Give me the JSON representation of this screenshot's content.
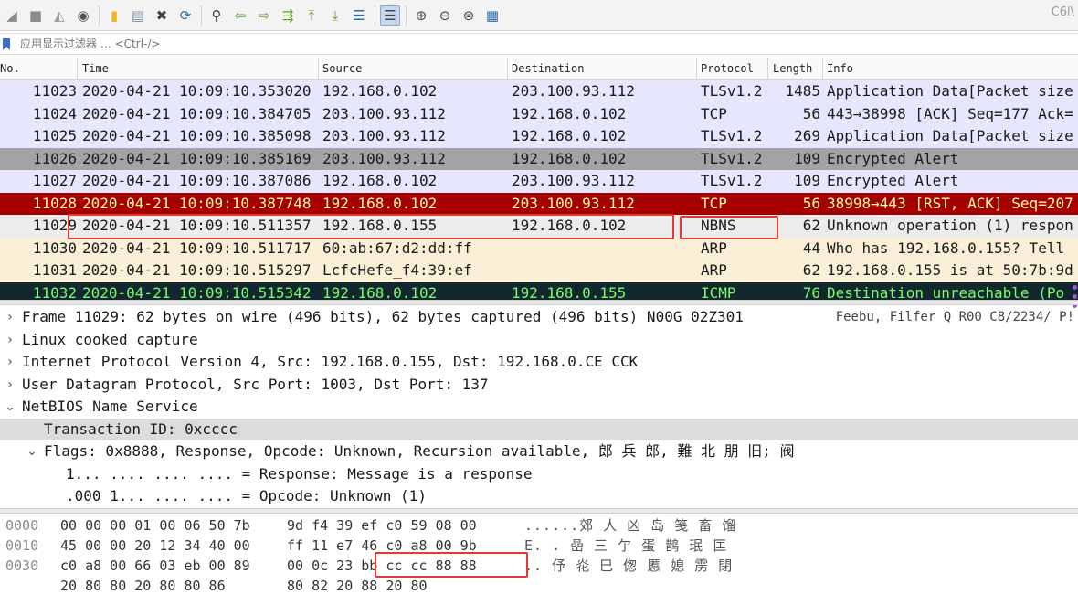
{
  "toolbar": {
    "version_badge": "C6l\\",
    "buttons": [
      {
        "name": "start-capture-icon",
        "glyph": "◢",
        "color": "#8a8a8a"
      },
      {
        "name": "stop-capture-icon",
        "glyph": "■",
        "color": "#8a8a8a"
      },
      {
        "name": "restart-capture-icon",
        "glyph": "◭",
        "color": "#9a9a9a"
      },
      {
        "name": "capture-options-icon",
        "glyph": "◉",
        "color": "#555555"
      },
      {
        "name": "open-file-icon",
        "glyph": "▮",
        "color": "#f0b429"
      },
      {
        "name": "save-file-icon",
        "glyph": "▤",
        "color": "#7a8aa0"
      },
      {
        "name": "close-file-icon",
        "glyph": "✖",
        "color": "#334455"
      },
      {
        "name": "reload-file-icon",
        "glyph": "⟳",
        "color": "#2b6cb0"
      },
      {
        "name": "find-packet-icon",
        "glyph": "⚲",
        "color": "#444444"
      },
      {
        "name": "go-back-icon",
        "glyph": "⇦",
        "color": "#5aa02c"
      },
      {
        "name": "go-forward-icon",
        "glyph": "⇨",
        "color": "#5aa02c"
      },
      {
        "name": "go-to-packet-icon",
        "glyph": "⇶",
        "color": "#5aa02c"
      },
      {
        "name": "go-first-icon",
        "glyph": "⤒",
        "color": "#5aa02c"
      },
      {
        "name": "go-last-icon",
        "glyph": "⤓",
        "color": "#5aa02c"
      },
      {
        "name": "autoscroll-icon",
        "glyph": "☰",
        "color": "#2b6cb0"
      },
      {
        "name": "colorize-icon",
        "glyph": "☰",
        "color": "#444444",
        "active": true
      },
      {
        "name": "zoom-in-icon",
        "glyph": "⊕",
        "color": "#444444"
      },
      {
        "name": "zoom-out-icon",
        "glyph": "⊖",
        "color": "#444444"
      },
      {
        "name": "zoom-reset-icon",
        "glyph": "⊜",
        "color": "#444444"
      },
      {
        "name": "resize-columns-icon",
        "glyph": "▦",
        "color": "#2b6cb0"
      }
    ]
  },
  "filter": {
    "placeholder": "应用显示过滤器 … <Ctrl-/>"
  },
  "columns": {
    "no": "No.",
    "time": "Time",
    "source": "Source",
    "destination": "Destination",
    "protocol": "Protocol",
    "length": "Length",
    "info": "Info"
  },
  "packets": [
    {
      "no": "11023",
      "time": "2020-04-21 10:09:10.353020",
      "src": "192.168.0.102",
      "dst": "203.100.93.112",
      "proto": "TLSv1.2",
      "len": "1485",
      "info": "Application Data[Packet size",
      "bg": "#e7e6ff",
      "fg": "#1a1a1a"
    },
    {
      "no": "11024",
      "time": "2020-04-21 10:09:10.384705",
      "src": "203.100.93.112",
      "dst": "192.168.0.102",
      "proto": "TCP",
      "len": "56",
      "info": "443→38998 [ACK] Seq=177 Ack=",
      "bg": "#e7e6ff",
      "fg": "#1a1a1a"
    },
    {
      "no": "11025",
      "time": "2020-04-21 10:09:10.385098",
      "src": "203.100.93.112",
      "dst": "192.168.0.102",
      "proto": "TLSv1.2",
      "len": "269",
      "info": "Application Data[Packet size",
      "bg": "#e7e6ff",
      "fg": "#1a1a1a"
    },
    {
      "no": "11026",
      "time": "2020-04-21 10:09:10.385169",
      "src": "203.100.93.112",
      "dst": "192.168.0.102",
      "proto": "TLSv1.2",
      "len": "109",
      "info": "Encrypted Alert",
      "bg": "#a3a3a3",
      "fg": "#1a1a1a"
    },
    {
      "no": "11027",
      "time": "2020-04-21 10:09:10.387086",
      "src": "192.168.0.102",
      "dst": "203.100.93.112",
      "proto": "TLSv1.2",
      "len": "109",
      "info": "Encrypted Alert",
      "bg": "#e7e6ff",
      "fg": "#1a1a1a"
    },
    {
      "no": "11028",
      "time": "2020-04-21 10:09:10.387748",
      "src": "192.168.0.102",
      "dst": "203.100.93.112",
      "proto": "TCP",
      "len": "56",
      "info": "38998→443 [RST, ACK] Seq=207",
      "bg": "#a40000",
      "fg": "#fffc9c"
    },
    {
      "no": "11029",
      "time": "2020-04-21 10:09:10.511357",
      "src": "192.168.0.155",
      "dst": "192.168.0.102",
      "proto": "NBNS",
      "len": "62",
      "info": "Unknown operation (1) respon",
      "bg": "#ececec",
      "fg": "#1a1a1a"
    },
    {
      "no": "11030",
      "time": "2020-04-21 10:09:10.511717",
      "src": "60:ab:67:d2:dd:ff",
      "dst": "",
      "proto": "ARP",
      "len": "44",
      "info": "Who has 192.168.0.155? Tell",
      "bg": "#faf0d7",
      "fg": "#1a1a1a"
    },
    {
      "no": "11031",
      "time": "2020-04-21 10:09:10.515297",
      "src": "LcfcHefe_f4:39:ef",
      "dst": "",
      "proto": "ARP",
      "len": "62",
      "info": "192.168.0.155 is at 50:7b:9d",
      "bg": "#faf0d7",
      "fg": "#1a1a1a"
    },
    {
      "no": "11032",
      "time": "2020-04-21 10:09:10.515342",
      "src": "192.168.0.102",
      "dst": "192.168.0.155",
      "proto": "ICMP",
      "len": "76",
      "info": "Destination unreachable (Po",
      "bg": "#12272e",
      "fg": "#78ff66"
    }
  ],
  "details": [
    {
      "arrow": "›",
      "text": "Frame 11029: 62 bytes on wire (496 bits), 62 bytes captured (496 bits) N00G 02Z301",
      "extra": "Feebu, Filfer Q R00 C8/2234/ P!",
      "indent": 0
    },
    {
      "arrow": "›",
      "text": "Linux cooked capture",
      "indent": 0
    },
    {
      "arrow": "›",
      "text": "Internet Protocol Version 4, Src: 192.168.0.155, Dst: 192.168.0.CE CCK",
      "indent": 0
    },
    {
      "arrow": "›",
      "text": "User Datagram Protocol, Src Port: 1003, Dst Port: 137",
      "indent": 0
    },
    {
      "arrow": "⌄",
      "text": "NetBIOS Name Service",
      "indent": 0
    },
    {
      "arrow": "",
      "text": "Transaction ID: 0xcccc",
      "indent": 1,
      "highlight": true
    },
    {
      "arrow": "⌄",
      "text": "Flags: 0x8888, Response, Opcode: Unknown, Recursion available, 郎 兵 郎, 難 北 朋 旧; 阀",
      "indent": 1
    },
    {
      "arrow": "",
      "text": "1... .... .... .... = Response: Message is a response",
      "indent": 2
    },
    {
      "arrow": "",
      "text": ".000 1... .... .... = Opcode: Unknown (1)",
      "indent": 2
    }
  ],
  "hex": [
    {
      "offset": "0000",
      "b1": "00 00 00 01 00 06 50 7b",
      "b2": "9d f4 39 ef c0 59 08 00",
      "ascii": "......郊 人 凶 岛 笺 畜 馏"
    },
    {
      "offset": "0010",
      "b1": "45 00 00 20 12 34 40 00",
      "b2": "ff 11 e7 46 c0 a8 00 9b",
      "ascii": "E.   .  嵒 三 亇 蛋 鹊 珉 匞"
    },
    {
      "offset": "0030",
      "b1": "c0 a8 00 66 03 eb 00 89",
      "b2": "00 0c 23 bb cc cc 88 88",
      "ascii": "   ..  伃 炛 巳 偬 慝 媳 雳 閉"
    },
    {
      "offset": "",
      "b1": "  20 80 80 20 80 80 86",
      "b2": "80 82 20 88 20 80",
      "ascii": ""
    }
  ]
}
